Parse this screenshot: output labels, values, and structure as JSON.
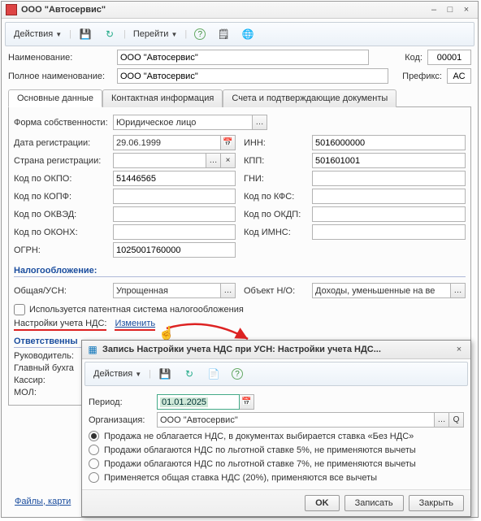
{
  "window": {
    "title": "ООО \"Автосервис\"",
    "toolbar": {
      "actions": "Действия",
      "go": "Перейти"
    }
  },
  "form": {
    "name_label": "Наименование:",
    "name_value": "ООО \"Автосервис\"",
    "code_label": "Код:",
    "code_value": "00001",
    "fullname_label": "Полное наименование:",
    "fullname_value": "ООО \"Автосервис\"",
    "prefix_label": "Префикс:",
    "prefix_value": "АС"
  },
  "tabs": {
    "main": "Основные данные",
    "contact": "Контактная информация",
    "accounts": "Счета и подтверждающие документы"
  },
  "main_tab": {
    "ownership_label": "Форма собственности:",
    "ownership_value": "Юридическое лицо",
    "regdate_label": "Дата регистрации:",
    "regdate_value": "29.06.1999",
    "country_label": "Страна регистрации:",
    "okpo_label": "Код по ОКПО:",
    "okpo_value": "51446565",
    "okopf_label": "Код по КОПФ:",
    "okved_label": "Код по ОКВЭД:",
    "okonh_label": "Код по ОКОНХ:",
    "ogrn_label": "ОГРН:",
    "ogrn_value": "1025001760000",
    "inn_label": "ИНН:",
    "inn_value": "5016000000",
    "kpp_label": "КПП:",
    "kpp_value": "501601001",
    "gni_label": "ГНИ:",
    "kfs_label": "Код по КФС:",
    "okdp_label": "Код по ОКДП:",
    "imns_label": "Код ИМНС:"
  },
  "tax": {
    "section": "Налогообложение:",
    "general_label": "Общая/УСН:",
    "general_value": "Упрощенная",
    "object_label": "Объект Н/О:",
    "object_value": "Доходы, уменьшенные на ве",
    "patent_label": "Используется патентная система налогообложения",
    "vat_settings_label": "Настройки учета НДС:",
    "change_link": "Изменить"
  },
  "resp": {
    "section": "Ответственны",
    "head_label": "Руководитель:",
    "accountant_label": "Главный бухга",
    "cashier_label": "Кассир:",
    "mol_label": "МОЛ:"
  },
  "footer": {
    "files_link": "Файлы, карти",
    "close": "Закрыть"
  },
  "dialog": {
    "title": "Запись Настройки учета НДС при УСН: Настройки учета НДС...",
    "toolbar_actions": "Действия",
    "period_label": "Период:",
    "period_value": "01.01.2025",
    "org_label": "Организация:",
    "org_value": "ООО \"Автосервис\"",
    "radio1": "Продажа не облагается НДС, в документах выбирается ставка «Без НДС»",
    "radio2": "Продажи облагаются НДС по льготной ставке 5%, не применяются вычеты",
    "radio3": "Продажи облагаются НДС по льготной ставке 7%, не применяются вычеты",
    "radio4": "Применяется общая ставка НДС (20%), применяются все вычеты",
    "ok": "OK",
    "save": "Записать",
    "close": "Закрыть"
  },
  "icons": {
    "minimize": "–",
    "maximize": "□",
    "close": "×"
  }
}
